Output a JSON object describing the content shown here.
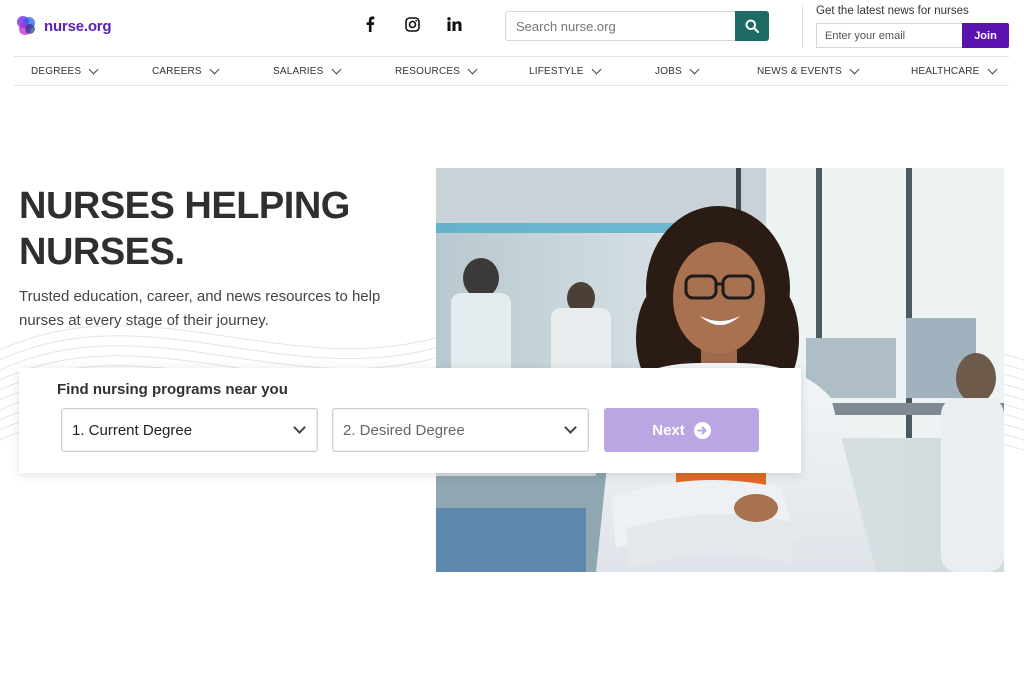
{
  "brand": {
    "name": "nurse.org"
  },
  "social": [
    {
      "name": "facebook-icon",
      "glyph": "f"
    },
    {
      "name": "instagram-icon",
      "glyph": ""
    },
    {
      "name": "linkedin-icon",
      "glyph": "in"
    }
  ],
  "search": {
    "placeholder": "Search nurse.org",
    "icon": "search-icon"
  },
  "newsletter": {
    "title": "Get the latest news for nurses",
    "email_placeholder": "Enter your email",
    "join_label": "Join"
  },
  "nav": [
    {
      "label": "DEGREES"
    },
    {
      "label": "CAREERS"
    },
    {
      "label": "SALARIES"
    },
    {
      "label": "RESOURCES"
    },
    {
      "label": "LIFESTYLE"
    },
    {
      "label": "JOBS"
    },
    {
      "label": "NEWS & EVENTS"
    },
    {
      "label": "HEALTHCARE"
    }
  ],
  "hero": {
    "title_line1": "NURSES HELPING",
    "title_line2": "NURSES.",
    "subtitle": "Trusted education, career, and news resources to help nurses at every stage of their journey."
  },
  "finder": {
    "title": "Find nursing programs near you",
    "current_degree": "1.  Current Degree",
    "desired_degree": "2.  Desired Degree",
    "next_label": "Next"
  },
  "colors": {
    "brand_purple": "#5b21b6",
    "join_purple": "#5b13b0",
    "search_teal": "#1d6b64",
    "next_lavender": "#b9a6e3"
  }
}
